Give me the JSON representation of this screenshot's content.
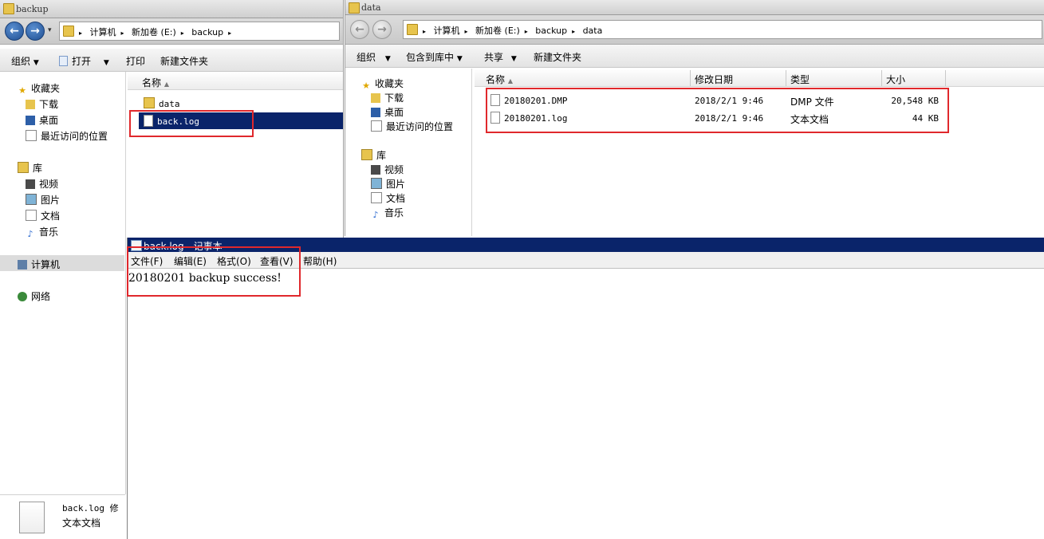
{
  "left_window": {
    "title": "backup",
    "breadcrumb": [
      "计算机",
      "新加卷 (E:)",
      "backup"
    ],
    "toolbar": {
      "organize": "组织",
      "open": "打开",
      "print": "打印",
      "new_folder": "新建文件夹"
    },
    "nav": {
      "favorites": "收藏夹",
      "downloads": "下载",
      "desktop": "桌面",
      "recent": "最近访问的位置",
      "libraries": "库",
      "videos": "视频",
      "pictures": "图片",
      "documents": "文档",
      "music": "音乐",
      "computer": "计算机",
      "network": "网络"
    },
    "column_name": "名称",
    "files": [
      {
        "name": "data"
      },
      {
        "name": "back.log"
      }
    ],
    "details": {
      "filename": "back.log 修",
      "type": "文本文档"
    }
  },
  "right_window": {
    "title": "data",
    "breadcrumb": [
      "计算机",
      "新加卷 (E:)",
      "backup",
      "data"
    ],
    "toolbar": {
      "organize": "组织",
      "include_library": "包含到库中",
      "share": "共享",
      "new_folder": "新建文件夹"
    },
    "nav": {
      "favorites": "收藏夹",
      "downloads": "下载",
      "desktop": "桌面",
      "recent": "最近访问的位置",
      "libraries": "库",
      "videos": "视频",
      "pictures": "图片",
      "documents": "文档",
      "music": "音乐"
    },
    "columns": {
      "name": "名称",
      "modified": "修改日期",
      "type": "类型",
      "size": "大小"
    },
    "files": [
      {
        "name": "20180201.DMP",
        "modified": "2018/2/1 9:46",
        "type": "DMP 文件",
        "size": "20,548 KB"
      },
      {
        "name": "20180201.log",
        "modified": "2018/2/1 9:46",
        "type": "文本文档",
        "size": "44 KB"
      }
    ]
  },
  "notepad": {
    "title": "back.log - 记事本",
    "menu": {
      "file": "文件(F)",
      "edit": "编辑(E)",
      "format": "格式(O)",
      "view": "查看(V)",
      "help": "帮助(H)"
    },
    "content": "20180201 backup success!"
  },
  "colors": {
    "selection": "#0a246a",
    "highlight_box": "#e0282c"
  }
}
